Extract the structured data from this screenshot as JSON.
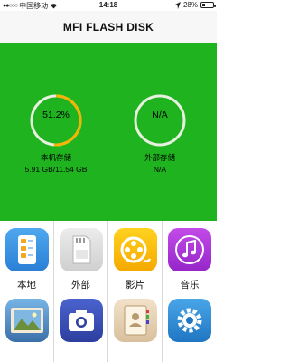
{
  "status_bar": {
    "carrier": "中国移动",
    "time": "14:18",
    "battery_text": "28%",
    "battery_level": 0.28
  },
  "nav": {
    "title": "MFI FLASH DISK"
  },
  "storage": {
    "local": {
      "percent_text": "51.2%",
      "percent_value": 0.512,
      "label": "本机存储",
      "detail": "5.91 GB/11.54 GB"
    },
    "external": {
      "percent_text": "N/A",
      "label": "外部存储",
      "detail": "N/A"
    },
    "colors": {
      "panel_bg": "#1fb31f",
      "ring_used": "#f5b400",
      "ring_track": "#e8f0e0"
    }
  },
  "grid": {
    "items": [
      {
        "label": "本地",
        "icon": "local-files-icon"
      },
      {
        "label": "外部",
        "icon": "sd-card-icon"
      },
      {
        "label": "影片",
        "icon": "film-reel-icon"
      },
      {
        "label": "音乐",
        "icon": "music-note-icon"
      },
      {
        "label": "",
        "icon": "photo-album-icon"
      },
      {
        "label": "",
        "icon": "camera-icon"
      },
      {
        "label": "",
        "icon": "contacts-book-icon"
      },
      {
        "label": "",
        "icon": "settings-gear-icon"
      }
    ]
  }
}
